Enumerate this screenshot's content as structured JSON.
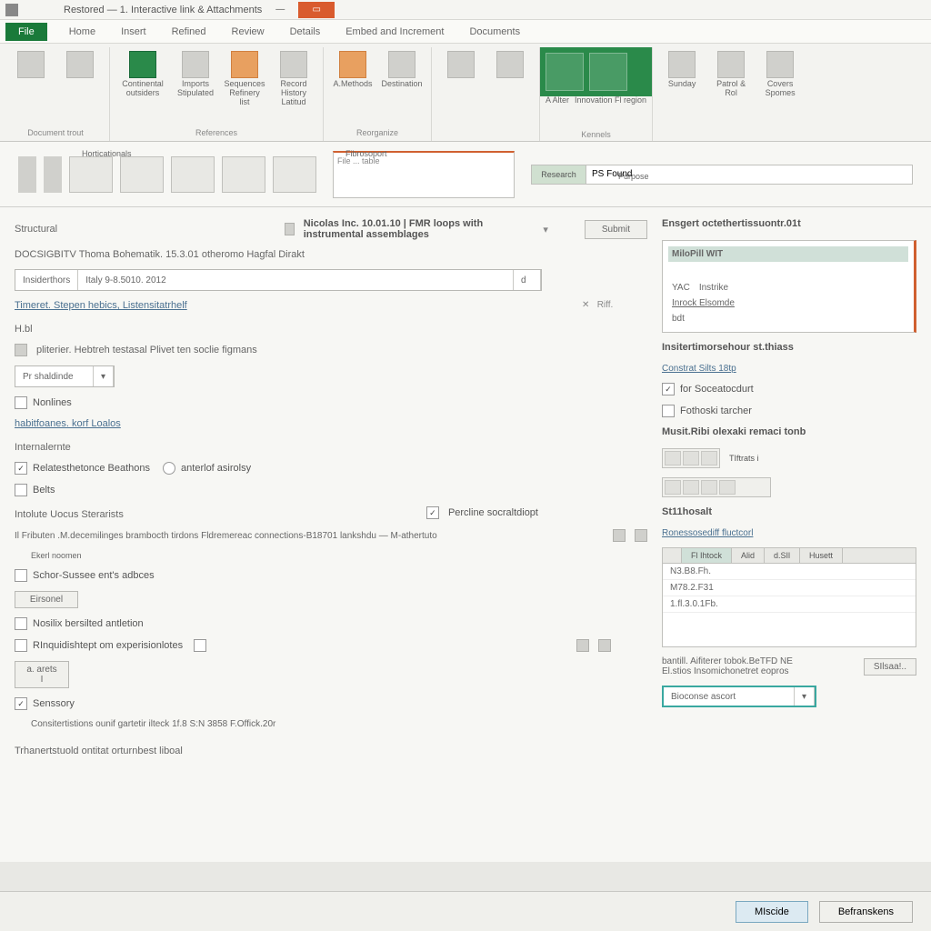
{
  "titlebar": {
    "title": "Restored — 1. Interactive link & Attachments"
  },
  "menubar": {
    "file": "File",
    "items": [
      "Home",
      "Insert",
      "Refined",
      "Review",
      "Details",
      "Embed and Increment",
      "Documents"
    ]
  },
  "ribbon": {
    "groups": [
      {
        "label": "Document trout",
        "buttons": [
          {
            "l": ""
          },
          {
            "l": ""
          }
        ]
      },
      {
        "label": "References",
        "buttons": [
          {
            "l": "Continental outsiders"
          },
          {
            "l": "Imports Stipulated"
          },
          {
            "l": "Sequences Refinery list"
          },
          {
            "l": "Record History Latitud"
          }
        ]
      },
      {
        "label": "Reorganize",
        "buttons": [
          {
            "l": "A.Methods"
          },
          {
            "l": "Destination"
          }
        ]
      },
      {
        "label": "",
        "buttons": [
          {
            "l": ""
          },
          {
            "l": ""
          }
        ]
      },
      {
        "label": "Kennels",
        "buttons": [
          {
            "l": "A Alter"
          },
          {
            "l": "Innovation Fl region"
          }
        ],
        "accent": true
      },
      {
        "label": "",
        "buttons": [
          {
            "l": "Sunday"
          },
          {
            "l": "Patrol & Rol"
          },
          {
            "l": "Covers Spomes"
          }
        ]
      }
    ]
  },
  "subribbon": {
    "preview_text": "File ... table",
    "search_label": "Research",
    "search_value": "PS Found",
    "tab_label": "Purpose"
  },
  "form": {
    "section_label": "Structural",
    "main_title": "Nicolas Inc. 10.01.10 | FMR loops with instrumental assemblages",
    "edit_btn": "Submit",
    "doc_line": "DOCSIGBITV Thoma Bohematik. 15.3.01 otheromo Hagfal Dirakt",
    "input_combo": {
      "seg1": "Insiderthors",
      "seg2": "Italy 9-8.5010. 2012",
      "seg3": "d"
    },
    "link1": "Timeret. Stepen hebics, Listensitatrhelf",
    "label_fields": "H.bl",
    "note1": "pliterier. Hebtreh testasal Plivet ten soclie figmans",
    "input2": "Pr shaldinde",
    "chk_headers": "Nonlines",
    "link2": "habitfoanes. korf Loalos",
    "section_internal": "Internalernte",
    "chk_auto1": "Relatesthetonce Beathons",
    "chk_auto2": "anterlof asirolsy",
    "chk_belts": "Belts",
    "section_docs": "Intolute Uocus Sterarists",
    "chk_ppath": "Percline socraltdiopt",
    "para": "Il Fributen .M.decemilinges brambocth tirdons Fldremereac connections-B18701 lankshdu — M-athertuto",
    "label_excel": "Ekerl noomen",
    "chk_strike": "Schor-Sussee ent's adbces",
    "btn_small": "Eirsonel",
    "chk_extended": "Nosilix bersilted antletion",
    "chk_ranges": "RInquidishtept om experisionlotes",
    "btn_inner": "a. arets I",
    "chk_sensor": "Senssory",
    "sub_sensor": "Consitertistions ounif gartetir ilteck 1f.8 S:N 3858 F.Offick.20r",
    "footer_note": "Trhanertstuold ontitat orturnbest liboal"
  },
  "side": {
    "header1": "Ensgert octethertissuontr.01t",
    "panel1": {
      "title": "MiloPill WIT",
      "row1a": "YAC",
      "row1b": "Instrike",
      "row2": "Inrock Elsomde",
      "row3": "bdt"
    },
    "header2": "Insitertimorsehour st.thiass",
    "link_step": "Constrat Silts 18tp",
    "chk_source": "for Soceatocdurt",
    "chk_other": "Fothoski tarcher",
    "header3": "Musit.Ribi olexaki remaci tonb",
    "toolbar_label": "TIftrats i",
    "header4": "St11hosalt",
    "link_recon": "Ronessosediff fluctcorl",
    "list_tabs": [
      "",
      "Fl Ihtock",
      "Alid",
      "d.SIl",
      "Husett"
    ],
    "list_rows": [
      "N3.B8.Fh.",
      "M78.2.F31",
      "1.fl.3.0.1Fb."
    ],
    "footer1": "bantill. Aifiterer tobok.BeTFD NE",
    "footer2": "El.stios Insomichonetret eopros",
    "btn_set": "SIlsaa!..",
    "dropdown": "Bioconse ascort"
  },
  "footer": {
    "ok": "MIscide",
    "cancel": "Befranskens"
  }
}
